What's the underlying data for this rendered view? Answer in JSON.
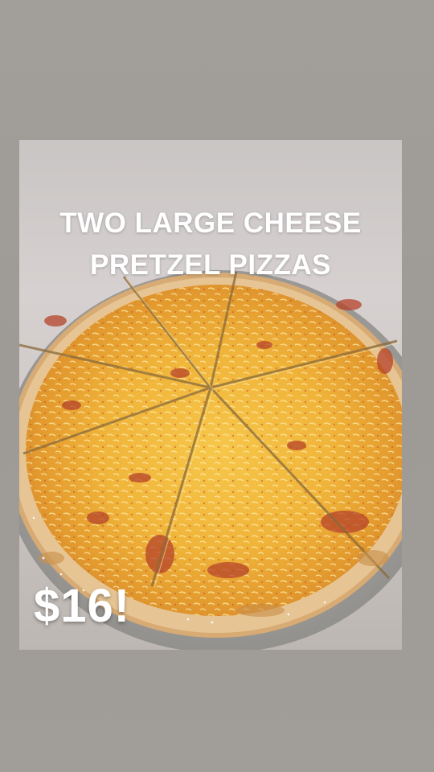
{
  "story": {
    "headline_line1": "TWO LARGE CHEESE",
    "headline_line2": "PRETZEL PIZZAS",
    "price": "$16!"
  },
  "photo": {
    "subject": "pizza-photo",
    "colors": {
      "cheese": "#f0b53a",
      "crust": "#e9c99a",
      "sauce": "#b8452a",
      "pan": "#a9a7a4"
    }
  }
}
